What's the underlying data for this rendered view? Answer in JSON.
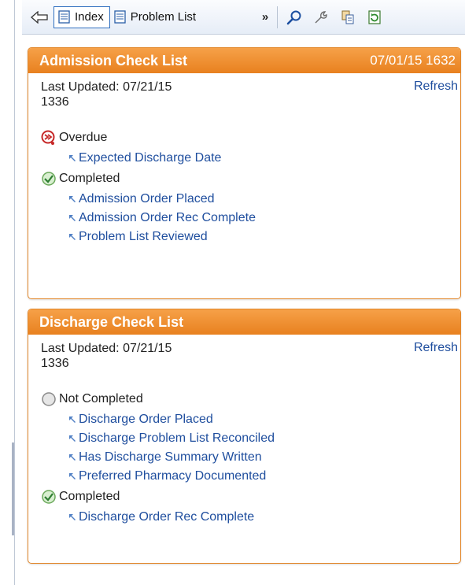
{
  "toolbar": {
    "tabs": [
      {
        "label": "Index",
        "active": true,
        "icon": "document-icon"
      },
      {
        "label": "Problem List",
        "active": false,
        "icon": "document-icon"
      }
    ],
    "overflow_label": "»",
    "buttons": [
      "search-icon",
      "tools-icon",
      "copy-icon",
      "refresh-icon"
    ]
  },
  "admission": {
    "title": "Admission Check List",
    "date": "07/01/15 1632",
    "updated_line1": "Last Updated: 07/21/15",
    "updated_line2": "1336",
    "refresh_label": "Refresh",
    "groups": [
      {
        "status": "Overdue",
        "icon": "overdue-icon",
        "items": [
          "Expected Discharge Date"
        ]
      },
      {
        "status": "Completed",
        "icon": "completed-icon",
        "items": [
          "Admission Order Placed",
          "Admission Order Rec Complete",
          "Problem List Reviewed"
        ]
      }
    ]
  },
  "discharge": {
    "title": "Discharge Check List",
    "updated_line1": "Last Updated: 07/21/15",
    "updated_line2": "1336",
    "refresh_label": "Refresh",
    "groups": [
      {
        "status": "Not Completed",
        "icon": "not-completed-icon",
        "items": [
          "Discharge Order Placed",
          "Discharge Problem List Reconciled",
          "Has Discharge Summary Written",
          "Preferred Pharmacy Documented"
        ]
      },
      {
        "status": "Completed",
        "icon": "completed-icon",
        "items": [
          "Discharge Order Rec Complete"
        ]
      }
    ]
  },
  "colors": {
    "header_orange": "#e8811f",
    "link_blue": "#1f4e9e",
    "complete_green": "#4caf50",
    "overdue_red": "#c62828"
  }
}
